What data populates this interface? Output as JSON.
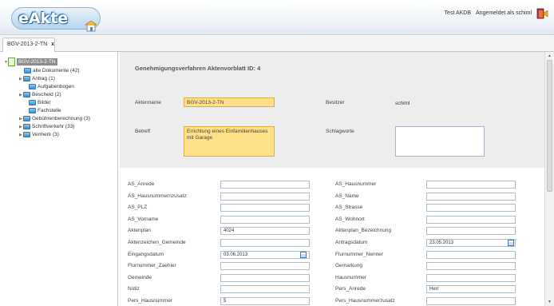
{
  "header": {
    "logo_text": "eAkte",
    "user_name": "Test AKDB",
    "login_status": "Angemeldet als schiml",
    "logout_icon": "logout-icon",
    "brand_color": "#2f6fad"
  },
  "tab": {
    "label": "BGV-2013-2-TN",
    "close": "x"
  },
  "tree": {
    "root": "BGV-2013-2-TN",
    "items": [
      "alle Dokumente (42)",
      "Antrag (1)",
      "Aufgabenbogen",
      "Bescheid (2)",
      "Bilder",
      "Fachstelle",
      "Gebührenberechnung (3)",
      "Schriftverkehr (33)",
      "Vermerk (3)"
    ]
  },
  "panel": {
    "title": "Genehmigungsverfahren Aktenvorblatt ID: 4",
    "aktenname_label": "Aktenname",
    "aktenname_value": "BGV-2013-2-TN",
    "besitzer_label": "Besitzer",
    "besitzer_value": "schiml",
    "betreff_label": "Betreff",
    "betreff_value": "Errichtung eines Einfamilienhauses mit Garage",
    "schlagworte_label": "Schlagworte"
  },
  "fields": [
    {
      "left": "AS_Anrede",
      "left_value": "",
      "right": "AS_Hausnummer",
      "right_value": ""
    },
    {
      "left": "AS_Hausnummernzusatz",
      "left_value": "",
      "right": "AS_Name",
      "right_value": ""
    },
    {
      "left": "AS_PLZ",
      "left_value": "",
      "right": "AS_Strasse",
      "right_value": ""
    },
    {
      "left": "AS_Vorname",
      "left_value": "",
      "right": "AS_Wohnort",
      "right_value": ""
    },
    {
      "left": "Aktenplan",
      "left_value": "4024",
      "right": "Aktenplan_Bezeichnung",
      "right_value": ""
    },
    {
      "left": "Aktenzeichen_Gemeinde",
      "left_value": "",
      "right": "Antragsdatum",
      "right_value": "23.05.2013"
    },
    {
      "left": "Eingangsdatum",
      "left_value": "03.06.2013",
      "right": "Flurnummer_Nenner",
      "right_value": ""
    },
    {
      "left": "Flurnummer_Zaehler",
      "left_value": "",
      "right": "Gemarkung",
      "right_value": ""
    },
    {
      "left": "Gemeinde",
      "left_value": "",
      "right": "Hausnummer",
      "right_value": ""
    },
    {
      "left": "Notiz",
      "left_value": "",
      "right": "Pers_Anrede",
      "right_value": "Herr"
    },
    {
      "left": "Pers_Hausnummer",
      "left_value": "5",
      "right": "Pers_Hausnummerzusatz",
      "right_value": ""
    }
  ]
}
